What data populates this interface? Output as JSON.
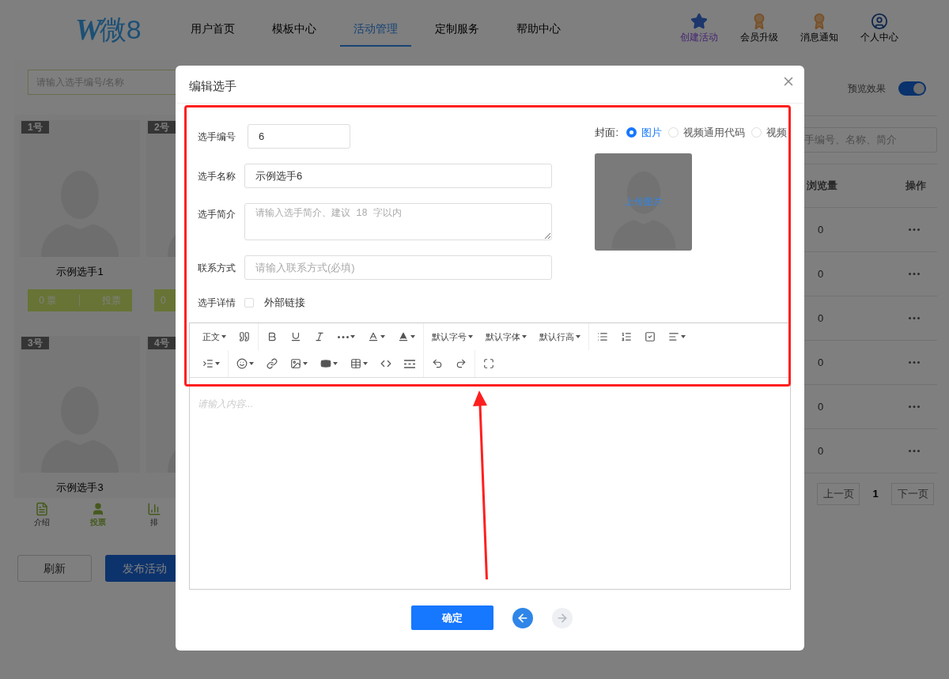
{
  "header": {
    "logo": {
      "letter": "W",
      "text": "微8"
    },
    "nav": [
      {
        "label": "用户首页",
        "selected": false
      },
      {
        "label": "模板中心",
        "selected": false
      },
      {
        "label": "活动管理",
        "selected": true
      },
      {
        "label": "定制服务",
        "selected": false
      },
      {
        "label": "帮助中心",
        "selected": false
      }
    ],
    "actions": [
      {
        "kind": "create",
        "label": "创建活动"
      },
      {
        "kind": "upgrade",
        "label": "会员升级"
      },
      {
        "kind": "messages",
        "label": "消息通知"
      },
      {
        "kind": "profile",
        "label": "个人中心"
      }
    ]
  },
  "preview": {
    "search": {
      "placeholder": "请输入选手编号/名称"
    },
    "cards": [
      {
        "badge": "1号",
        "name": "示例选手1",
        "votes": "0 票",
        "vote_button": "投票"
      },
      {
        "badge": "2号",
        "votes": "0"
      },
      {
        "badge": "3号",
        "name": "示例选手3"
      },
      {
        "badge": "4号"
      }
    ],
    "tabbar": [
      {
        "kind": "intro",
        "label": "介绍",
        "selected": false
      },
      {
        "kind": "vote",
        "label": "投票",
        "selected": true
      },
      {
        "kind": "rank",
        "label": "排",
        "selected": false
      }
    ],
    "buttons": [
      {
        "kind": "secondary",
        "label": "刷新"
      },
      {
        "kind": "primary",
        "label": "发布活动"
      }
    ]
  },
  "side": {
    "preview_toggle": {
      "label": "预览效果",
      "on": true
    },
    "search": {
      "placeholder": "手编号、名称、简介"
    },
    "table": {
      "columns": [
        "浏览量",
        "操作"
      ],
      "rows": [
        {
          "views": "0"
        },
        {
          "views": "0"
        },
        {
          "views": "0"
        },
        {
          "views": "0"
        },
        {
          "views": "0"
        },
        {
          "views": "0"
        }
      ]
    },
    "pagination": {
      "prev": "上一页",
      "page": "1",
      "next": "下一页"
    }
  },
  "dialog": {
    "title": "编辑选手",
    "form": {
      "number": {
        "label": "选手编号",
        "value": "6"
      },
      "name": {
        "label": "选手名称",
        "value": "示例选手6"
      },
      "intro": {
        "label": "选手简介",
        "placeholder": "请输入选手简介、建议 18 字以内"
      },
      "contact": {
        "label": "联系方式",
        "placeholder": "请输入联系方式(必填)"
      },
      "details": {
        "label": "选手详情",
        "external_link": {
          "label": "外部链接",
          "checked": false
        }
      }
    },
    "cover": {
      "label": "封面:",
      "options": [
        {
          "label": "图片",
          "selected": true
        },
        {
          "label": "视频通用代码",
          "selected": false
        },
        {
          "label": "视频",
          "selected": false
        }
      ],
      "upload": "上传图片"
    },
    "editor": {
      "toolbar": [
        [
          [
            {
              "kind": "select",
              "label": "正文"
            },
            {
              "kind": "quote"
            }
          ],
          [
            {
              "kind": "bold"
            },
            {
              "kind": "underline"
            },
            {
              "kind": "italic"
            },
            {
              "kind": "more"
            },
            {
              "kind": "color"
            },
            {
              "kind": "bgcolor"
            }
          ],
          [
            {
              "kind": "select",
              "label": "默认字号"
            },
            {
              "kind": "select",
              "label": "默认字体"
            },
            {
              "kind": "select",
              "label": "默认行高"
            }
          ],
          [
            {
              "kind": "bullets"
            },
            {
              "kind": "numbers"
            },
            {
              "kind": "todo"
            },
            {
              "kind": "align"
            }
          ]
        ],
        [
          [
            {
              "kind": "indent"
            }
          ],
          [
            {
              "kind": "emoji"
            },
            {
              "kind": "link"
            },
            {
              "kind": "image"
            },
            {
              "kind": "video"
            },
            {
              "kind": "table"
            },
            {
              "kind": "code"
            },
            {
              "kind": "divider"
            }
          ],
          [
            {
              "kind": "undo"
            },
            {
              "kind": "redo"
            }
          ],
          [
            {
              "kind": "fullscreen"
            }
          ]
        ]
      ],
      "placeholder": "请输入内容..."
    },
    "confirm": "确定",
    "back": {
      "disabled": false
    },
    "forward": {
      "disabled": true
    }
  }
}
